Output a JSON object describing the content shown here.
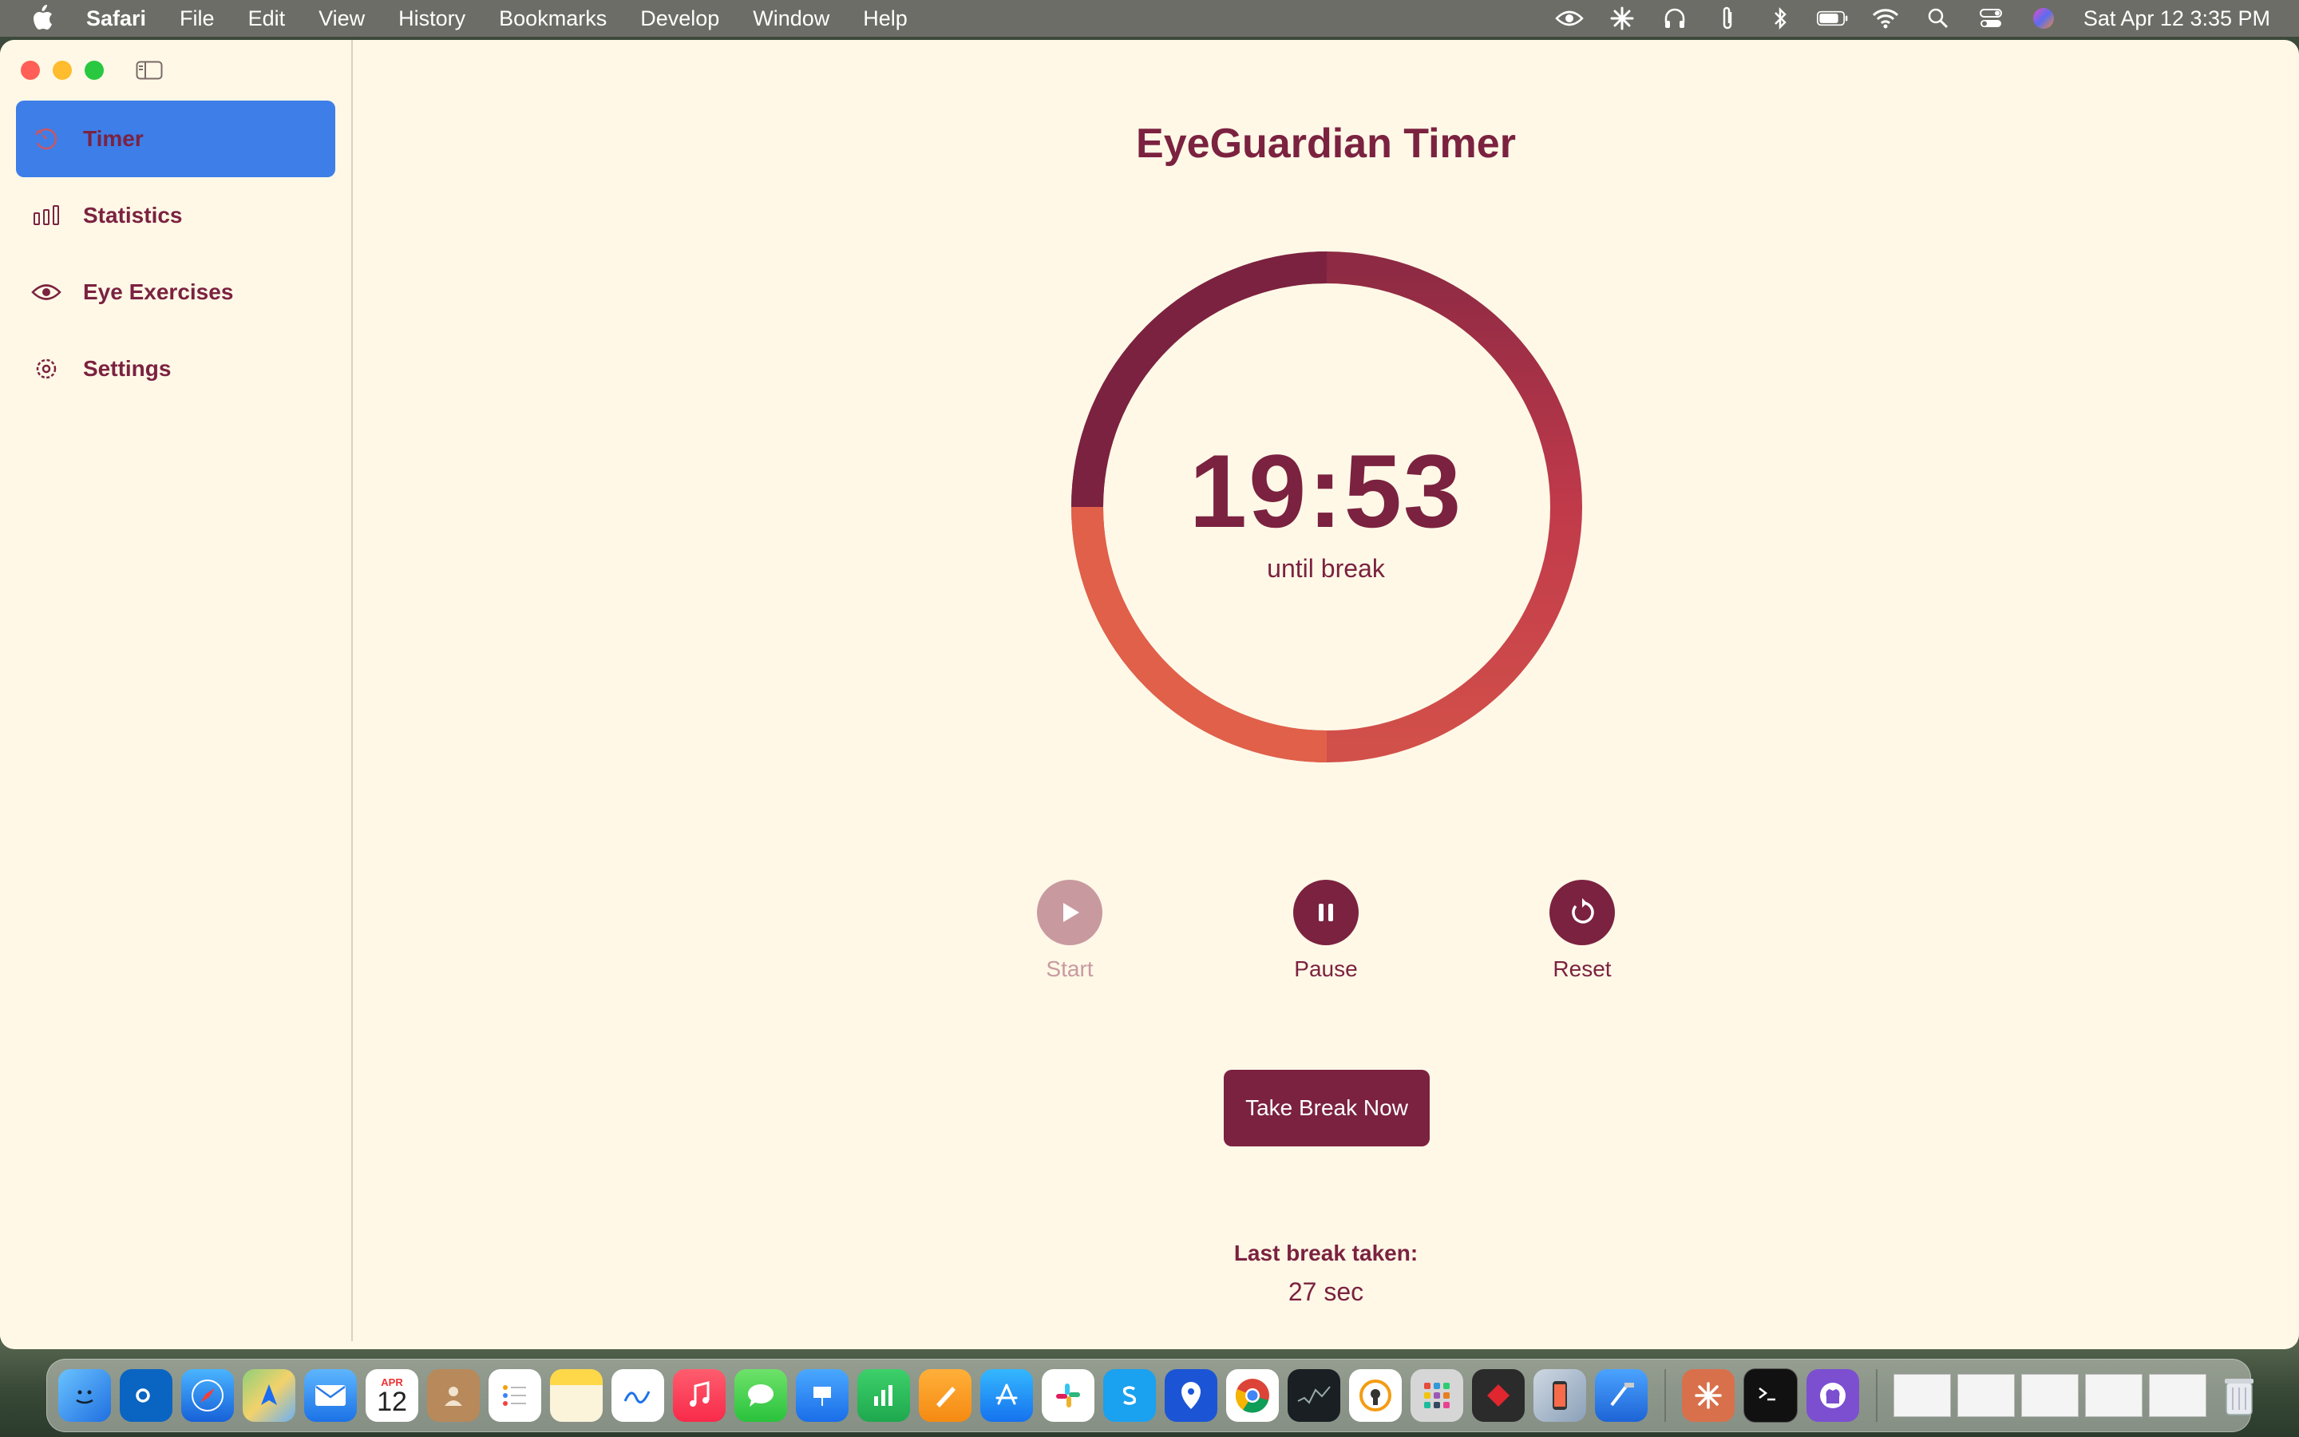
{
  "menubar": {
    "app_name": "Safari",
    "menus": [
      "File",
      "Edit",
      "View",
      "History",
      "Bookmarks",
      "Develop",
      "Window",
      "Help"
    ],
    "clock": "Sat Apr 12  3:35 PM",
    "status_icons": [
      "eye-icon",
      "sparkle-icon",
      "headphones-icon",
      "paperclip-icon",
      "bluetooth-icon",
      "battery-icon",
      "wifi-icon",
      "search-icon",
      "control-center-icon",
      "siri-icon"
    ]
  },
  "sidebar": {
    "items": [
      {
        "label": "Timer",
        "icon": "timer-icon",
        "active": true
      },
      {
        "label": "Statistics",
        "icon": "bar-chart-icon",
        "active": false
      },
      {
        "label": "Eye Exercises",
        "icon": "eye-icon",
        "active": false
      },
      {
        "label": "Settings",
        "icon": "gear-icon",
        "active": false
      }
    ]
  },
  "main": {
    "title": "EyeGuardian Timer",
    "time": "19:53",
    "time_caption": "until break",
    "controls": {
      "start": {
        "label": "Start",
        "enabled": false
      },
      "pause": {
        "label": "Pause",
        "enabled": true
      },
      "reset": {
        "label": "Reset",
        "enabled": true
      }
    },
    "break_button": "Take Break Now",
    "last_break_label": "Last break taken:",
    "last_break_value": "27 sec",
    "progress_fraction": 0.25
  },
  "colors": {
    "accent": "#7b2240",
    "background": "#fff8e7",
    "active_nav": "#3d7ee8",
    "ring_gradient": [
      "#7b2240",
      "#c03a4a",
      "#e0604a"
    ]
  },
  "dock": {
    "calendar_month": "APR",
    "calendar_day": "12"
  }
}
